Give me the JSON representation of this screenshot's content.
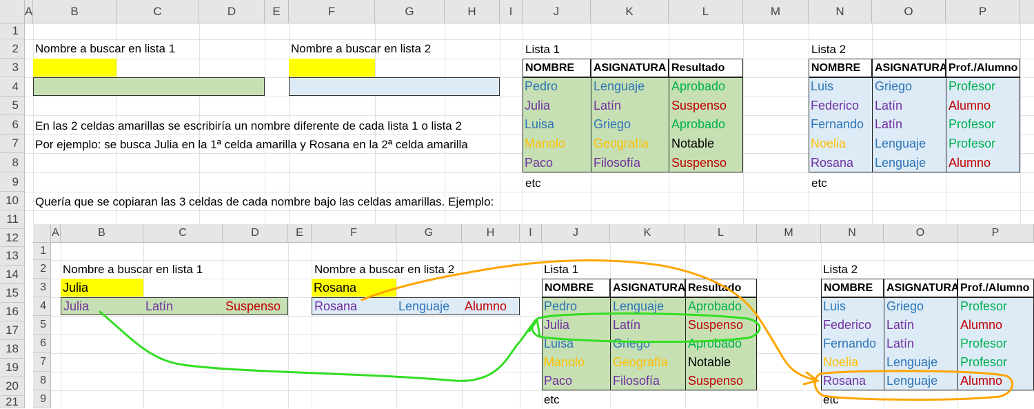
{
  "columns": [
    "A",
    "B",
    "C",
    "D",
    "E",
    "F",
    "G",
    "H",
    "I",
    "J",
    "K",
    "L",
    "M",
    "N",
    "O",
    "P"
  ],
  "rows": [
    "1",
    "2",
    "3",
    "4",
    "5",
    "6",
    "7",
    "8",
    "9",
    "10",
    "11",
    "12",
    "13",
    "14",
    "15",
    "16",
    "17",
    "18",
    "19",
    "20",
    "21"
  ],
  "inner_rows": [
    "1",
    "2",
    "3",
    "4",
    "5",
    "6",
    "7",
    "8",
    "9"
  ],
  "labels": {
    "buscar1": "Nombre a buscar en lista 1",
    "buscar2": "Nombre a buscar en lista 2",
    "lista1": "Lista 1",
    "lista2": "Lista 2",
    "etc": "etc",
    "note1": "En las 2 celdas amarillas se escribiría un nombre diferente de cada lista 1 o lista 2",
    "note2": "Por ejemplo: se busca Julia en la 1ª celda amarilla y Rosana en la 2ª celda amarilla",
    "note3": "Quería que se copiaran las 3 celdas de cada nombre bajo las celdas amarillas. Ejemplo:"
  },
  "lista1": {
    "headers": [
      "NOMBRE",
      "ASIGNATURA",
      "Resultado"
    ],
    "rows": [
      {
        "nombre": "Pedro",
        "asignatura": "Lenguaje",
        "resultado": "Aprobado"
      },
      {
        "nombre": "Julia",
        "asignatura": "Latín",
        "resultado": "Suspenso"
      },
      {
        "nombre": "Luisa",
        "asignatura": "Griego",
        "resultado": "Aprobado"
      },
      {
        "nombre": "Manolo",
        "asignatura": "Geografía",
        "resultado": "Notable"
      },
      {
        "nombre": "Paco",
        "asignatura": "Filosofía",
        "resultado": "Suspenso"
      }
    ]
  },
  "lista2": {
    "headers": [
      "NOMBRE",
      "ASIGNATURA",
      "Prof./Alumno"
    ],
    "rows": [
      {
        "nombre": "Luis",
        "asignatura": "Griego",
        "rol": "Profesor"
      },
      {
        "nombre": "Federico",
        "asignatura": "Latín",
        "rol": "Alumno"
      },
      {
        "nombre": "Fernando",
        "asignatura": "Latín",
        "rol": "Profesor"
      },
      {
        "nombre": "Noelia",
        "asignatura": "Lenguaje",
        "rol": "Profesor"
      },
      {
        "nombre": "Rosana",
        "asignatura": "Lenguaje",
        "rol": "Alumno"
      }
    ]
  },
  "example": {
    "search1": "Julia",
    "search2": "Rosana",
    "result1": [
      "Julia",
      "Latín",
      "Suspenso"
    ],
    "result2": [
      "Rosana",
      "Lenguaje",
      "Alumno"
    ]
  },
  "colors": {
    "yellow": "#ffff00",
    "green_fill": "#c6e0b4",
    "blue_fill": "#ddebf7",
    "annot_green": "#33dd22",
    "annot_orange": "#ffa500"
  }
}
